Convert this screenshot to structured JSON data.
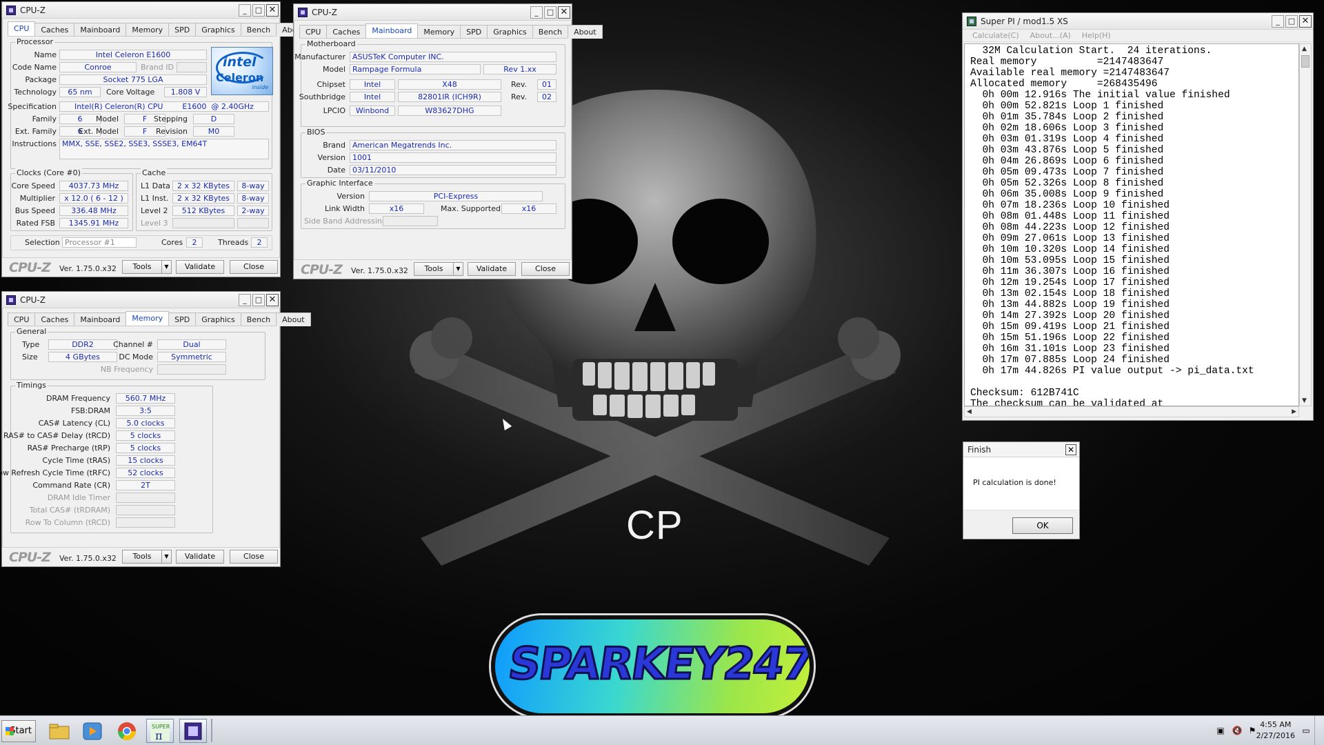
{
  "cpuz_common": {
    "title": "CPU-Z",
    "version": "Ver. 1.75.0.x32",
    "tools": "Tools",
    "validate": "Validate",
    "close": "Close",
    "tabs": [
      "CPU",
      "Caches",
      "Mainboard",
      "Memory",
      "SPD",
      "Graphics",
      "Bench",
      "About"
    ],
    "logo": "CPU-Z"
  },
  "cpu": {
    "processor_label": "Processor",
    "name_label": "Name",
    "name": "Intel Celeron E1600",
    "codename_label": "Code Name",
    "codename": "Conroe",
    "brandid_label": "Brand ID",
    "package_label": "Package",
    "package": "Socket 775 LGA",
    "technology_label": "Technology",
    "technology": "65 nm",
    "corevoltage_label": "Core Voltage",
    "corevoltage": "1.808 V",
    "spec_label": "Specification",
    "spec": "Intel(R) Celeron(R) CPU        E1600  @ 2.40GHz",
    "family_label": "Family",
    "family": "6",
    "model_label": "Model",
    "model": "F",
    "stepping_label": "Stepping",
    "stepping": "D",
    "extfamily_label": "Ext. Family",
    "extfamily": "6",
    "extmodel_label": "Ext. Model",
    "extmodel": "F",
    "revision_label": "Revision",
    "revision": "M0",
    "instructions_label": "Instructions",
    "instructions": "MMX, SSE, SSE2, SSE3, SSSE3, EM64T",
    "intel_logo": {
      "brand": "intel",
      "product": "Celeron",
      "tag": "inside"
    },
    "clocks_label": "Clocks (Core #0)",
    "corespeed_label": "Core Speed",
    "corespeed": "4037.73 MHz",
    "multiplier_label": "Multiplier",
    "multiplier": "x 12.0 ( 6 - 12 )",
    "busspeed_label": "Bus Speed",
    "busspeed": "336.48 MHz",
    "ratedfsb_label": "Rated FSB",
    "ratedfsb": "1345.91 MHz",
    "cache_label": "Cache",
    "l1data_label": "L1 Data",
    "l1data": "2 x 32 KBytes",
    "l1data_way": "8-way",
    "l1inst_label": "L1 Inst.",
    "l1inst": "2 x 32 KBytes",
    "l1inst_way": "8-way",
    "l2_label": "Level 2",
    "l2": "512 KBytes",
    "l2_way": "2-way",
    "l3_label": "Level 3",
    "selection_label": "Selection",
    "selection": "Processor #1",
    "cores_label": "Cores",
    "cores": "2",
    "threads_label": "Threads",
    "threads": "2"
  },
  "mainboard": {
    "motherboard_label": "Motherboard",
    "manufacturer_label": "Manufacturer",
    "manufacturer": "ASUSTeK Computer INC.",
    "model_label": "Model",
    "model": "Rampage Formula",
    "rev": "Rev 1.xx",
    "chipset_label": "Chipset",
    "chipset_vendor": "Intel",
    "chipset": "X48",
    "chipset_rev_label": "Rev.",
    "chipset_rev": "01",
    "southbridge_label": "Southbridge",
    "sb_vendor": "Intel",
    "southbridge": "82801IR (ICH9R)",
    "sb_rev_label": "Rev.",
    "sb_rev": "02",
    "lpcio_label": "LPCIO",
    "lpcio_vendor": "Winbond",
    "lpcio": "W83627DHG",
    "bios_label": "BIOS",
    "brand_label": "Brand",
    "brand": "American Megatrends Inc.",
    "version_label": "Version",
    "version": "1001",
    "date_label": "Date",
    "date": "03/11/2010",
    "gi_label": "Graphic Interface",
    "giversion_label": "Version",
    "giversion": "PCI-Express",
    "linkwidth_label": "Link Width",
    "linkwidth": "x16",
    "maxsupported_label": "Max. Supported",
    "maxsupported": "x16",
    "sideband_label": "Side Band Addressing"
  },
  "memory": {
    "general_label": "General",
    "type_label": "Type",
    "type": "DDR2",
    "channel_label": "Channel #",
    "channel": "Dual",
    "size_label": "Size",
    "size": "4 GBytes",
    "dcmode_label": "DC Mode",
    "dcmode": "Symmetric",
    "nbfreq_label": "NB Frequency",
    "timings_label": "Timings",
    "timings": [
      {
        "label": "DRAM Frequency",
        "value": "560.7 MHz",
        "grey": false
      },
      {
        "label": "FSB:DRAM",
        "value": "3:5",
        "grey": false
      },
      {
        "label": "CAS# Latency (CL)",
        "value": "5.0 clocks",
        "grey": false
      },
      {
        "label": "RAS# to CAS# Delay (tRCD)",
        "value": "5 clocks",
        "grey": false
      },
      {
        "label": "RAS# Precharge (tRP)",
        "value": "5 clocks",
        "grey": false
      },
      {
        "label": "Cycle Time (tRAS)",
        "value": "15 clocks",
        "grey": false
      },
      {
        "label": "Row Refresh Cycle Time (tRFC)",
        "value": "52 clocks",
        "grey": false
      },
      {
        "label": "Command Rate (CR)",
        "value": "2T",
        "grey": false
      },
      {
        "label": "DRAM Idle Timer",
        "value": "",
        "grey": true
      },
      {
        "label": "Total CAS# (tRDRAM)",
        "value": "",
        "grey": true
      },
      {
        "label": "Row To Column (tRCD)",
        "value": "",
        "grey": true
      }
    ]
  },
  "superpi": {
    "title": "Super PI / mod1.5 XS",
    "menu": [
      "Calculate(C)",
      "About...(A)",
      "Help(H)"
    ],
    "lines": [
      "  32M Calculation Start.  24 iterations.",
      "Real memory          =2147483647",
      "Available real memory =2147483647",
      "Allocated memory     =268435496",
      "  0h 00m 12.916s The initial value finished",
      "  0h 00m 52.821s Loop 1 finished",
      "  0h 01m 35.784s Loop 2 finished",
      "  0h 02m 18.606s Loop 3 finished",
      "  0h 03m 01.319s Loop 4 finished",
      "  0h 03m 43.876s Loop 5 finished",
      "  0h 04m 26.869s Loop 6 finished",
      "  0h 05m 09.473s Loop 7 finished",
      "  0h 05m 52.326s Loop 8 finished",
      "  0h 06m 35.008s Loop 9 finished",
      "  0h 07m 18.236s Loop 10 finished",
      "  0h 08m 01.448s Loop 11 finished",
      "  0h 08m 44.223s Loop 12 finished",
      "  0h 09m 27.061s Loop 13 finished",
      "  0h 10m 10.320s Loop 14 finished",
      "  0h 10m 53.095s Loop 15 finished",
      "  0h 11m 36.307s Loop 16 finished",
      "  0h 12m 19.254s Loop 17 finished",
      "  0h 13m 02.154s Loop 18 finished",
      "  0h 13m 44.882s Loop 19 finished",
      "  0h 14m 27.392s Loop 20 finished",
      "  0h 15m 09.419s Loop 21 finished",
      "  0h 15m 51.196s Loop 22 finished",
      "  0h 16m 31.101s Loop 23 finished",
      "  0h 17m 07.885s Loop 24 finished",
      "  0h 17m 44.826s PI value output -> pi_data.txt",
      "",
      "Checksum: 612B741C",
      "The checksum can be validated at"
    ]
  },
  "finish": {
    "title": "Finish",
    "message": "PI calculation is done!",
    "ok": "OK"
  },
  "desktop": {
    "cp_text": "CP",
    "logo_text": "SPARKEY247"
  },
  "taskbar": {
    "start": "Start",
    "time": "4:55 AM",
    "date": "2/27/2016"
  }
}
